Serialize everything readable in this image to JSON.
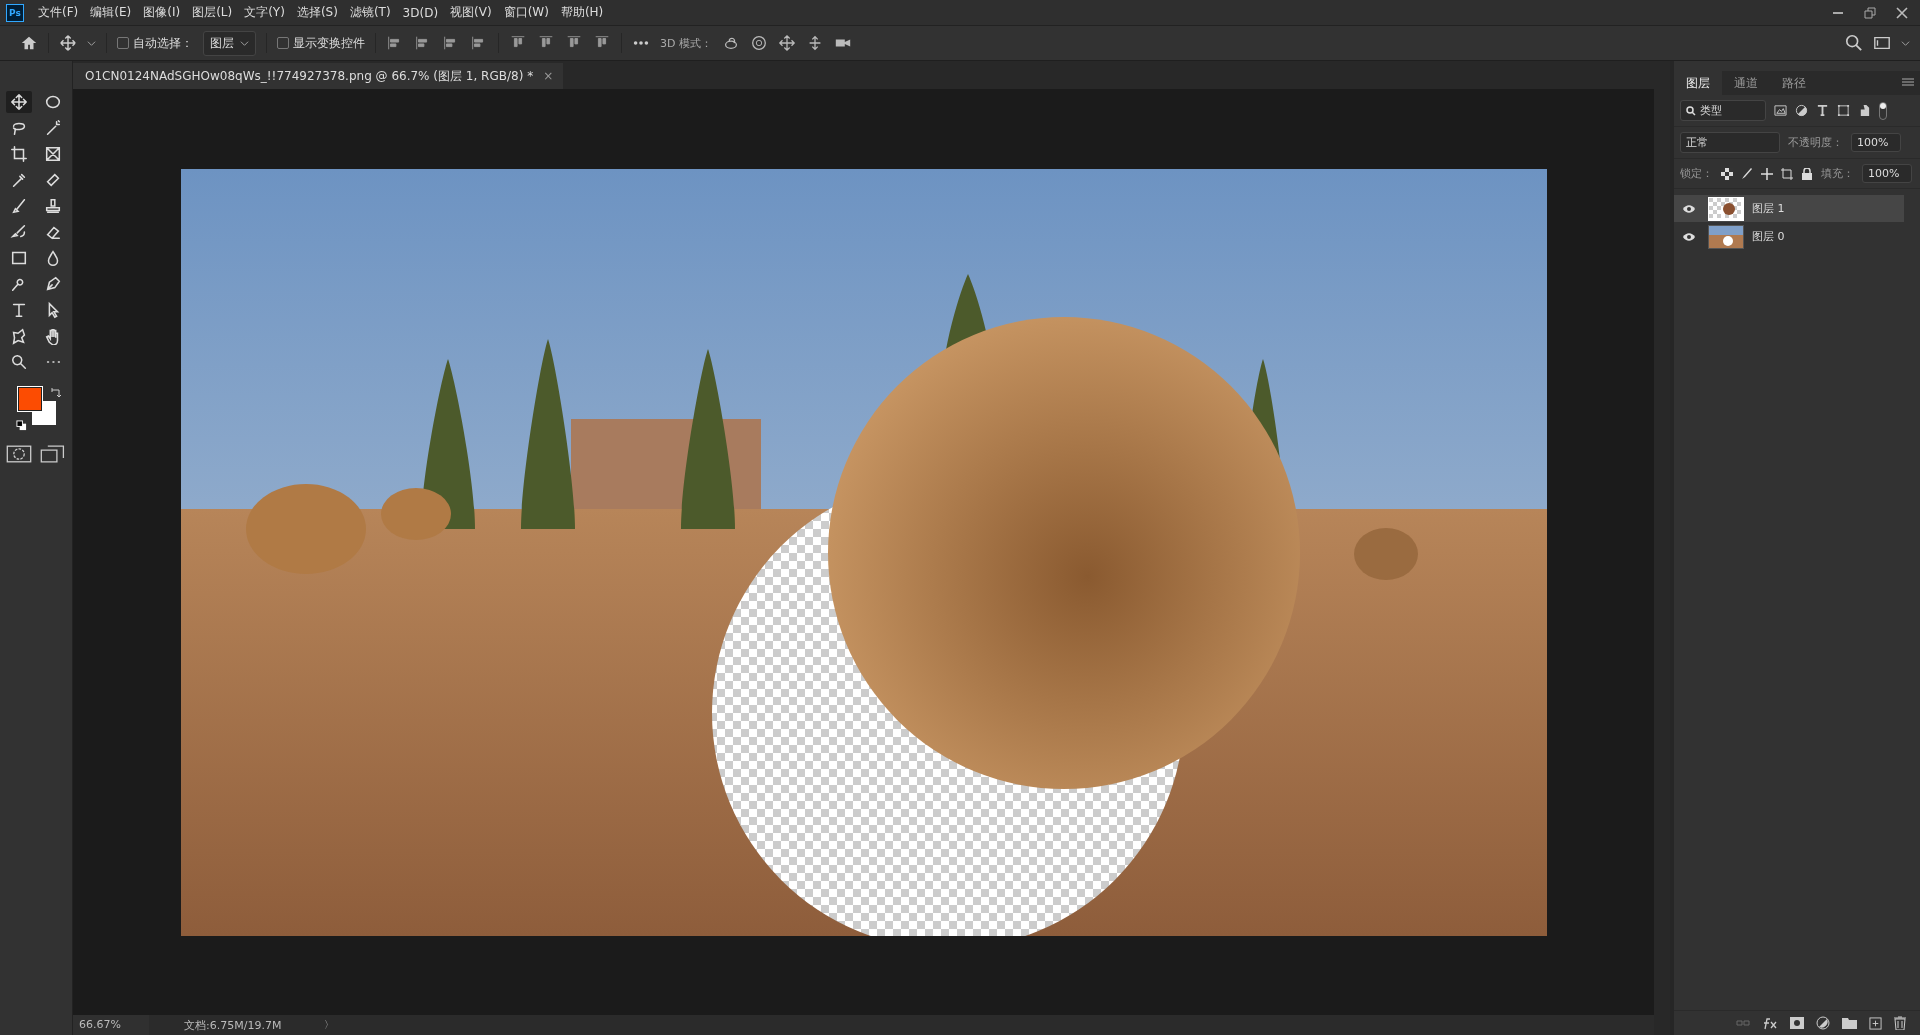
{
  "app_logo": "Ps",
  "menu": [
    "文件(F)",
    "编辑(E)",
    "图像(I)",
    "图层(L)",
    "文字(Y)",
    "选择(S)",
    "滤镜(T)",
    "3D(D)",
    "视图(V)",
    "窗口(W)",
    "帮助(H)"
  ],
  "options_bar": {
    "auto_select": {
      "label": "自动选择：",
      "checked": false
    },
    "target": "图层",
    "transform_controls": {
      "label": "显示变换控件",
      "checked": false
    },
    "mode_3d_label": "3D 模式："
  },
  "document_tab": {
    "title": "O1CN0124NAdSGHOw08qWs_!!774927378.png @ 66.7% (图层 1, RGB/8) *",
    "close": "×"
  },
  "toolbar": {
    "tools": [
      {
        "selected": true
      },
      {
        "selected": false
      },
      {
        "selected": false
      },
      {
        "selected": false
      },
      {
        "selected": false
      },
      {
        "selected": false
      },
      {
        "selected": false
      },
      {
        "selected": false
      },
      {
        "selected": false
      },
      {
        "selected": false
      },
      {
        "selected": false
      },
      {
        "selected": false
      },
      {
        "selected": false
      },
      {
        "selected": false
      },
      {
        "selected": false
      },
      {
        "selected": false
      },
      {
        "selected": false
      },
      {
        "selected": false
      },
      {
        "selected": false
      },
      {
        "selected": false
      },
      {
        "selected": false
      },
      {
        "selected": false
      }
    ],
    "foreground": {
      "color": "#fc4c02"
    },
    "background": {
      "color": "#ffffff"
    }
  },
  "layers_panel": {
    "tabs": [
      {
        "label": "图层",
        "selected": true
      },
      {
        "label": "通道",
        "selected": false
      },
      {
        "label": "路径",
        "selected": false
      }
    ],
    "filter": "类型",
    "blend_mode": "正常",
    "opacity_label": "不透明度：",
    "opacity": "100%",
    "lock_label": "锁定：",
    "fill_label": "填充：",
    "fill": "100%",
    "layers": [
      {
        "name": "图层 1",
        "visible": true,
        "selected": true,
        "kind": "cutout"
      },
      {
        "name": "图层 0",
        "visible": true,
        "selected": false,
        "kind": "photo"
      }
    ]
  },
  "status_bar": {
    "zoom": "66.67%",
    "doc_size": "文档:6.75M/19.7M",
    "arrow": "〉"
  }
}
